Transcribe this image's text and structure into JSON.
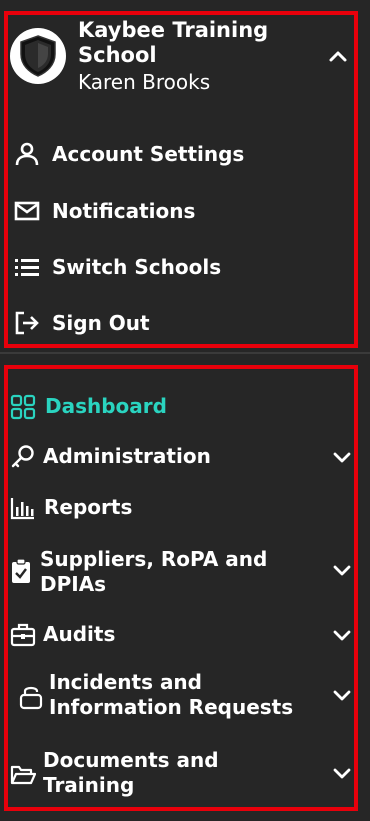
{
  "account": {
    "school_name": "Kaybee Training School",
    "user_name": "Karen Brooks",
    "items": [
      {
        "label": "Account Settings",
        "icon": "user-icon"
      },
      {
        "label": "Notifications",
        "icon": "envelope-icon"
      },
      {
        "label": "Switch Schools",
        "icon": "list-icon"
      },
      {
        "label": "Sign Out",
        "icon": "sign-out-icon"
      }
    ]
  },
  "nav": {
    "items": [
      {
        "label": "Dashboard",
        "icon": "dashboard-grid-icon",
        "active": true
      },
      {
        "label": "Administration",
        "icon": "key-icon"
      },
      {
        "label": "Reports",
        "icon": "bar-chart-icon"
      },
      {
        "label": "Suppliers, RoPA and DPIAs",
        "icon": "clipboard-check-icon"
      },
      {
        "label": "Audits",
        "icon": "toolbox-icon"
      },
      {
        "label": "Incidents and Information Requests",
        "icon": "lock-icon"
      },
      {
        "label": "Documents and Training",
        "icon": "folder-open-icon"
      }
    ]
  },
  "colors": {
    "background": "#262626",
    "highlight_border": "#e8000b",
    "active": "#2ad4c0",
    "text": "#ffffff"
  }
}
